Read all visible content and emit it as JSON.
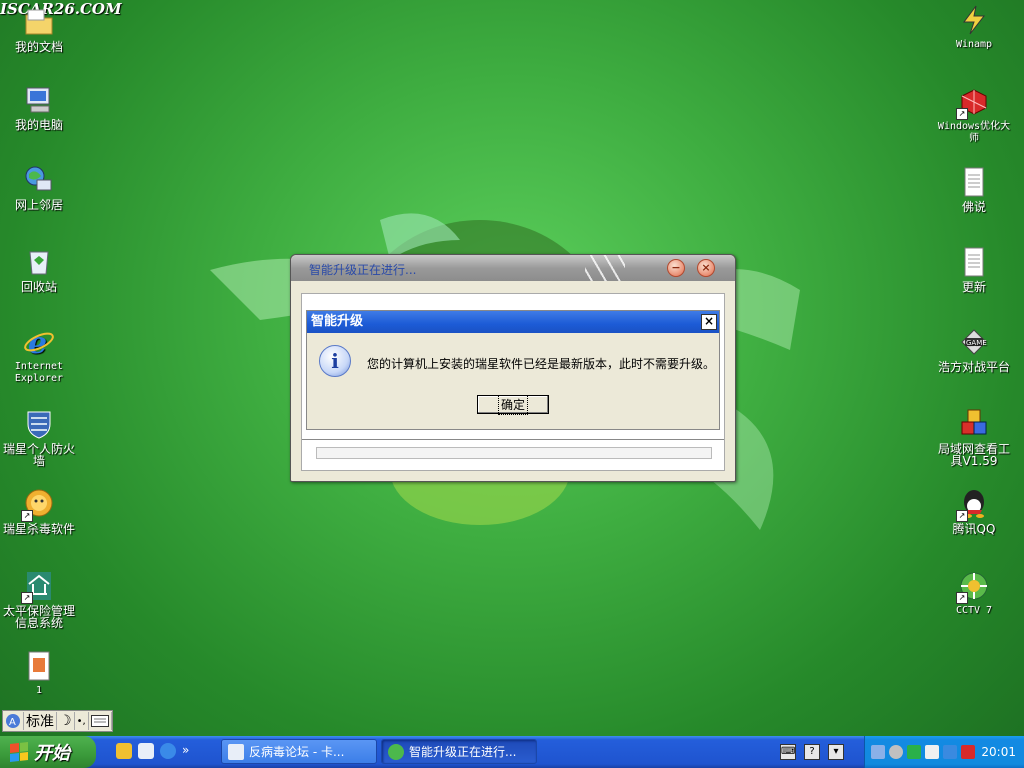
{
  "watermark": "ISCAR26.COM",
  "desktop": {
    "left_icons": [
      {
        "label": "我的文档",
        "icon": "folder-icon"
      },
      {
        "label": "我的电脑",
        "icon": "computer-icon"
      },
      {
        "label": "网上邻居",
        "icon": "network-icon"
      },
      {
        "label": "回收站",
        "icon": "recycle-bin-icon"
      },
      {
        "label": "Internet Explorer",
        "icon": "ie-icon"
      },
      {
        "label": "瑞星个人防火墙",
        "icon": "firewall-icon"
      },
      {
        "label": "瑞星杀毒软件",
        "icon": "antivirus-icon"
      },
      {
        "label": "太平保险管理信息系统",
        "icon": "insurance-icon"
      },
      {
        "label": "1",
        "icon": "document-icon"
      }
    ],
    "right_icons": [
      {
        "label": "Winamp",
        "icon": "winamp-icon"
      },
      {
        "label": "Windows优化大师",
        "icon": "optimizer-icon"
      },
      {
        "label": "佛说",
        "icon": "text-file-icon"
      },
      {
        "label": "更新",
        "icon": "text-file-icon"
      },
      {
        "label": "浩方对战平台",
        "icon": "game-icon"
      },
      {
        "label": "局域网查看工具V1.59",
        "icon": "lan-tool-icon"
      },
      {
        "label": "腾讯QQ",
        "icon": "qq-icon"
      },
      {
        "label": "CCTV 7",
        "icon": "cctv-icon"
      }
    ]
  },
  "outer_window": {
    "title": "智能升级正在进行...",
    "minimize": "−",
    "close": "×"
  },
  "dialog": {
    "title": "智能升级",
    "close": "×",
    "icon_glyph": "i",
    "message": "您的计算机上安装的瑞星软件已经是最新版本，此时不需要升级。",
    "ok": "确定"
  },
  "ime_bar": {
    "mode": "标准",
    "moon": "☽",
    "punct": "•,"
  },
  "taskbar": {
    "start": "开始",
    "tasks": [
      {
        "label": "反病毒论坛 - 卡...",
        "active": false
      },
      {
        "label": "智能升级正在进行...",
        "active": true
      }
    ],
    "clock": "20:01",
    "chevron": "»"
  }
}
